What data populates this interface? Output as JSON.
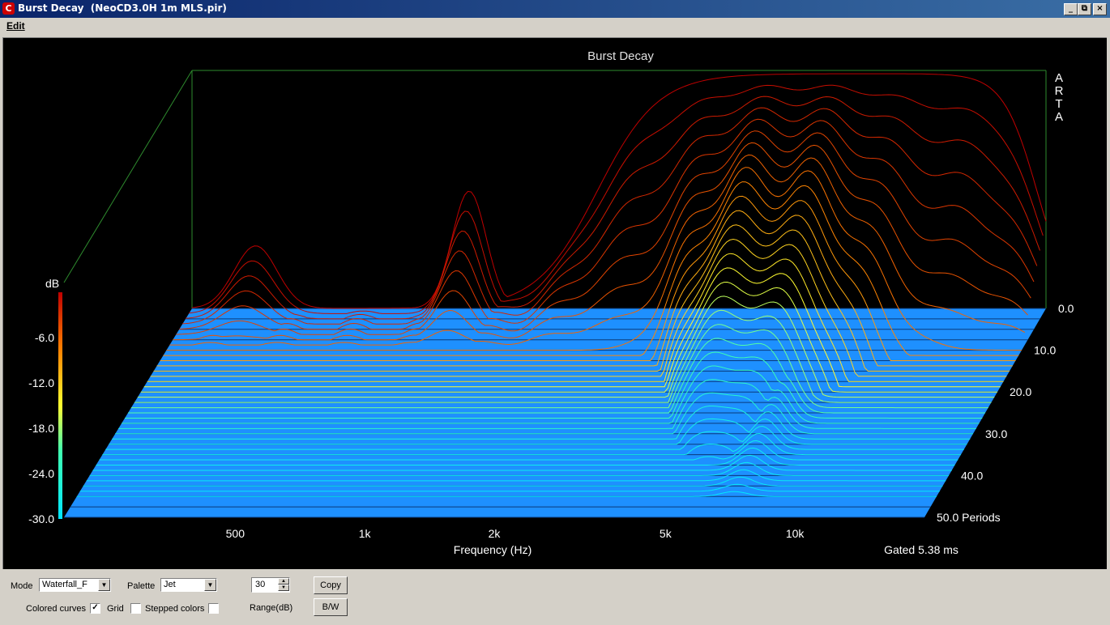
{
  "window": {
    "title": "Burst Decay  (NeoCD3.0H 1m MLS.pir)",
    "icon": "arta-app-icon",
    "controls": {
      "minimize": "_",
      "restore": "⧉",
      "close": "×"
    }
  },
  "menu": {
    "items": [
      "Edit"
    ]
  },
  "plot": {
    "title": "Burst Decay",
    "watermark": "ARTA",
    "colorbar_title": "dB",
    "gated_label": "Gated 5.38 ms",
    "background": "#000000",
    "floor_color": "#1e90ff",
    "frame_color": "#2e8b2e"
  },
  "chart_data": {
    "type": "waterfall",
    "title": "Burst Decay",
    "xlabel": "Frequency (Hz)",
    "x_scale": "log",
    "xlim": [
      200,
      20000
    ],
    "x_ticks": [
      "500",
      "1k",
      "2k",
      "5k",
      "10k"
    ],
    "x_tick_values": [
      500,
      1000,
      2000,
      5000,
      10000
    ],
    "z_unit": "Periods",
    "z_ticks": [
      "0.0",
      "10.0",
      "20.0",
      "30.0",
      "40.0",
      "50.0 Periods"
    ],
    "z_tick_values": [
      0,
      10,
      20,
      30,
      40,
      50
    ],
    "zlim": [
      0,
      50
    ],
    "ylabel": "dB",
    "ylim": [
      -30,
      0
    ],
    "y_ticks": [
      "-6.0",
      "-12.0",
      "-18.0",
      "-24.0",
      "-30.0"
    ],
    "y_tick_values": [
      -6,
      -12,
      -18,
      -24,
      -30
    ],
    "palette": "Jet",
    "range_db": 30
  },
  "controls": {
    "mode_label": "Mode",
    "mode_value": "Waterfall_F",
    "palette_label": "Palette",
    "palette_value": "Jet",
    "range_value": "30",
    "range_label": "Range(dB)",
    "copy_button": "Copy",
    "bw_button": "B/W",
    "colored_curves_label": "Colored curves",
    "colored_curves_checked": "✓",
    "grid_label": "Grid",
    "stepped_colors_label": "Stepped colors"
  }
}
